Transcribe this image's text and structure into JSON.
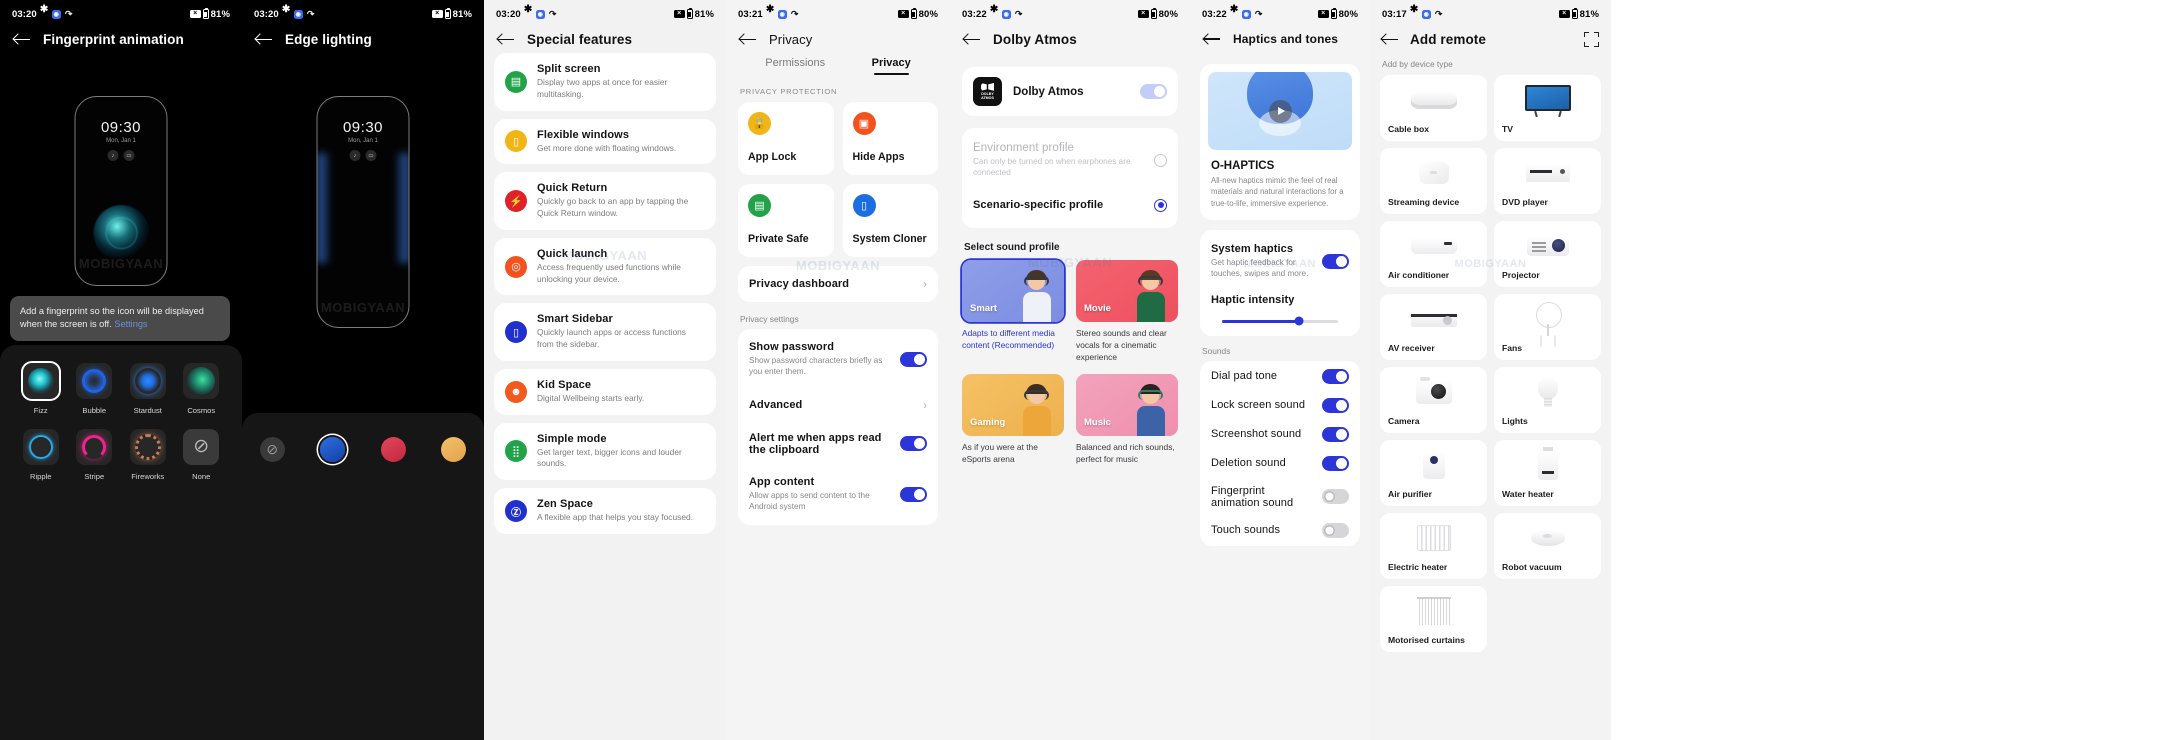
{
  "panels": {
    "fingerprint": {
      "status": {
        "time": "03:20",
        "battery": "81%"
      },
      "title": "Fingerprint animation",
      "preview": {
        "time": "09:30",
        "date": "Mon, Jan 1"
      },
      "tooltip": {
        "text": "Add a fingerprint so the icon will be displayed when the screen is off.",
        "link": "Settings"
      },
      "animations": [
        {
          "label": "Fizz",
          "selected": true
        },
        {
          "label": "Bubble",
          "selected": false
        },
        {
          "label": "Stardust",
          "selected": false
        },
        {
          "label": "Cosmos",
          "selected": false
        },
        {
          "label": "Ripple",
          "selected": false
        },
        {
          "label": "Stripe",
          "selected": false
        },
        {
          "label": "Fireworks",
          "selected": false
        },
        {
          "label": "None",
          "selected": false
        }
      ],
      "watermark": "MOBIGYAAN"
    },
    "edge_lighting": {
      "status": {
        "time": "03:20",
        "battery": "81%"
      },
      "title": "Edge lighting",
      "preview": {
        "time": "09:30",
        "date": "Mon, Jan 1"
      },
      "colors": [
        {
          "name": "none",
          "hex": "#3a3a3a",
          "selected": false
        },
        {
          "name": "blue",
          "hex": "#2f6fe0",
          "selected": true
        },
        {
          "name": "red",
          "hex": "#e0485c",
          "selected": false
        },
        {
          "name": "amber",
          "hex": "#f3c06a",
          "selected": false
        }
      ],
      "watermark": "MOBIGYAAN"
    },
    "special_features": {
      "status": {
        "time": "03:20",
        "battery": "81%"
      },
      "title": "Special features",
      "items": [
        {
          "title": "Split screen",
          "sub": "Display two apps at once for easier multitasking.",
          "color": "#22a34a",
          "icon": "split-screen-icon"
        },
        {
          "title": "Flexible windows",
          "sub": "Get more done with floating windows.",
          "color": "#f2b518",
          "icon": "flexible-windows-icon"
        },
        {
          "title": "Quick Return",
          "sub": "Quickly go back to an app by tapping the Quick Return window.",
          "color": "#e0212a",
          "icon": "quick-return-icon"
        },
        {
          "title": "Quick launch",
          "sub": "Access frequently used functions while unlocking your device.",
          "color": "#f2521e",
          "icon": "quick-launch-icon"
        },
        {
          "title": "Smart Sidebar",
          "sub": "Quickly launch apps or access functions from the sidebar.",
          "color": "#2030cc",
          "icon": "smart-sidebar-icon"
        },
        {
          "title": "Kid Space",
          "sub": "Digital Wellbeing starts early.",
          "color": "#f2591e",
          "icon": "kid-space-icon"
        },
        {
          "title": "Simple mode",
          "sub": "Get larger text, bigger icons and louder sounds.",
          "color": "#22a34a",
          "icon": "simple-mode-icon"
        },
        {
          "title": "Zen Space",
          "sub": "A flexible app that helps you stay focused.",
          "color": "#2030cc",
          "icon": "zen-space-icon"
        }
      ],
      "watermark": "MOBIGYAAN"
    },
    "privacy": {
      "status": {
        "time": "03:21",
        "battery": "80%"
      },
      "title": "Privacy",
      "tabs": [
        {
          "label": "Permissions",
          "active": false
        },
        {
          "label": "Privacy",
          "active": true
        }
      ],
      "section_protection": "PRIVACY PROTECTION",
      "tiles": [
        {
          "label": "App Lock",
          "color": "#f2b518",
          "icon": "app-lock-icon"
        },
        {
          "label": "Hide Apps",
          "color": "#f2521e",
          "icon": "hide-apps-icon"
        },
        {
          "label": "Private Safe",
          "color": "#22a34a",
          "icon": "private-safe-icon"
        },
        {
          "label": "System Cloner",
          "color": "#1a6ee0",
          "icon": "system-cloner-icon"
        }
      ],
      "dashboard_row": {
        "label": "Privacy dashboard",
        "chevron": "›"
      },
      "section_settings": "Privacy settings",
      "settings": [
        {
          "title": "Show password",
          "sub": "Show password characters briefly as you enter them.",
          "control": "toggle",
          "on": true
        },
        {
          "title": "Advanced",
          "sub": "",
          "control": "chevron",
          "on": false
        },
        {
          "title": "Alert me when apps read the clipboard",
          "sub": "",
          "control": "toggle",
          "on": true
        },
        {
          "title": "App content",
          "sub": "Allow apps to send content to the Android system",
          "control": "toggle",
          "on": true
        }
      ],
      "watermark": "MOBIGYAAN"
    },
    "dolby": {
      "status": {
        "time": "03:22",
        "battery": "80%"
      },
      "title": "Dolby Atmos",
      "master": {
        "label": "Dolby Atmos",
        "logo_line1": "DOLBY",
        "logo_line2": "ATMOS",
        "on": false
      },
      "profiles_radio": [
        {
          "title": "Environment profile",
          "sub": "Can only be turned on when earphones are connected",
          "selected": false,
          "disabled": true
        },
        {
          "title": "Scenario-specific profile",
          "sub": "",
          "selected": true,
          "disabled": false
        }
      ],
      "select_heading": "Select sound profile",
      "sound_profiles": [
        {
          "tag": "Smart",
          "desc": "Adapts to different media content (Recommended)",
          "selected": true
        },
        {
          "tag": "Movie",
          "desc": "Stereo sounds and clear vocals for a cinematic experience",
          "selected": false
        },
        {
          "tag": "Gaming",
          "desc": "As if you were at the eSports arena",
          "selected": false
        },
        {
          "tag": "Music",
          "desc": "Balanced and rich sounds, perfect for music",
          "selected": false
        }
      ],
      "watermark": "MOBIGYAAN"
    },
    "haptics": {
      "status": {
        "time": "03:22",
        "battery": "80%"
      },
      "title": "Haptics and tones",
      "hero": {
        "title": "O-HAPTICS",
        "sub": "All-new haptics mimic the feel of real materials and natural interactions for a true-to-life, immersive experience.",
        "play_icon": "play-icon"
      },
      "system_haptics": {
        "title": "System haptics",
        "sub": "Get haptic feedback for touches, swipes and more.",
        "on": true
      },
      "haptic_intensity": {
        "label": "Haptic intensity",
        "percent": 66
      },
      "sounds_heading": "Sounds",
      "sounds": [
        {
          "label": "Dial pad tone",
          "on": true
        },
        {
          "label": "Lock screen sound",
          "on": true
        },
        {
          "label": "Screenshot sound",
          "on": true
        },
        {
          "label": "Deletion sound",
          "on": true
        },
        {
          "label": "Fingerprint animation sound",
          "on": false
        },
        {
          "label": "Touch sounds",
          "on": false
        }
      ],
      "watermark": "MOBIGYAAN"
    },
    "add_remote": {
      "status": {
        "time": "03:17",
        "battery": "81%"
      },
      "title": "Add remote",
      "scan_icon": "scan-icon",
      "section": "Add by device type",
      "devices": [
        {
          "label": "Cable box",
          "art": "a-cablebox"
        },
        {
          "label": "TV",
          "art": "a-tv"
        },
        {
          "label": "Streaming device",
          "art": "a-stream"
        },
        {
          "label": "DVD player",
          "art": "a-dvd"
        },
        {
          "label": "Air conditioner",
          "art": "a-ac"
        },
        {
          "label": "Projector",
          "art": "a-proj"
        },
        {
          "label": "AV receiver",
          "art": "a-av"
        },
        {
          "label": "Fans",
          "art": "a-fan"
        },
        {
          "label": "Camera",
          "art": "a-cam"
        },
        {
          "label": "Lights",
          "art": "a-bulb"
        },
        {
          "label": "Air purifier",
          "art": "a-purifier"
        },
        {
          "label": "Water heater",
          "art": "a-wheater"
        },
        {
          "label": "Electric heater",
          "art": "a-radiator"
        },
        {
          "label": "Robot vacuum",
          "art": "a-vac"
        },
        {
          "label": "Motorised curtains",
          "art": "a-curtain"
        }
      ],
      "watermark": "MOBIGYAAN"
    }
  },
  "colors": {
    "accent_blue": "#2b35d8",
    "light_bg": "#f4f4f5",
    "card_white": "#ffffff",
    "dark_bg": "#000000"
  }
}
